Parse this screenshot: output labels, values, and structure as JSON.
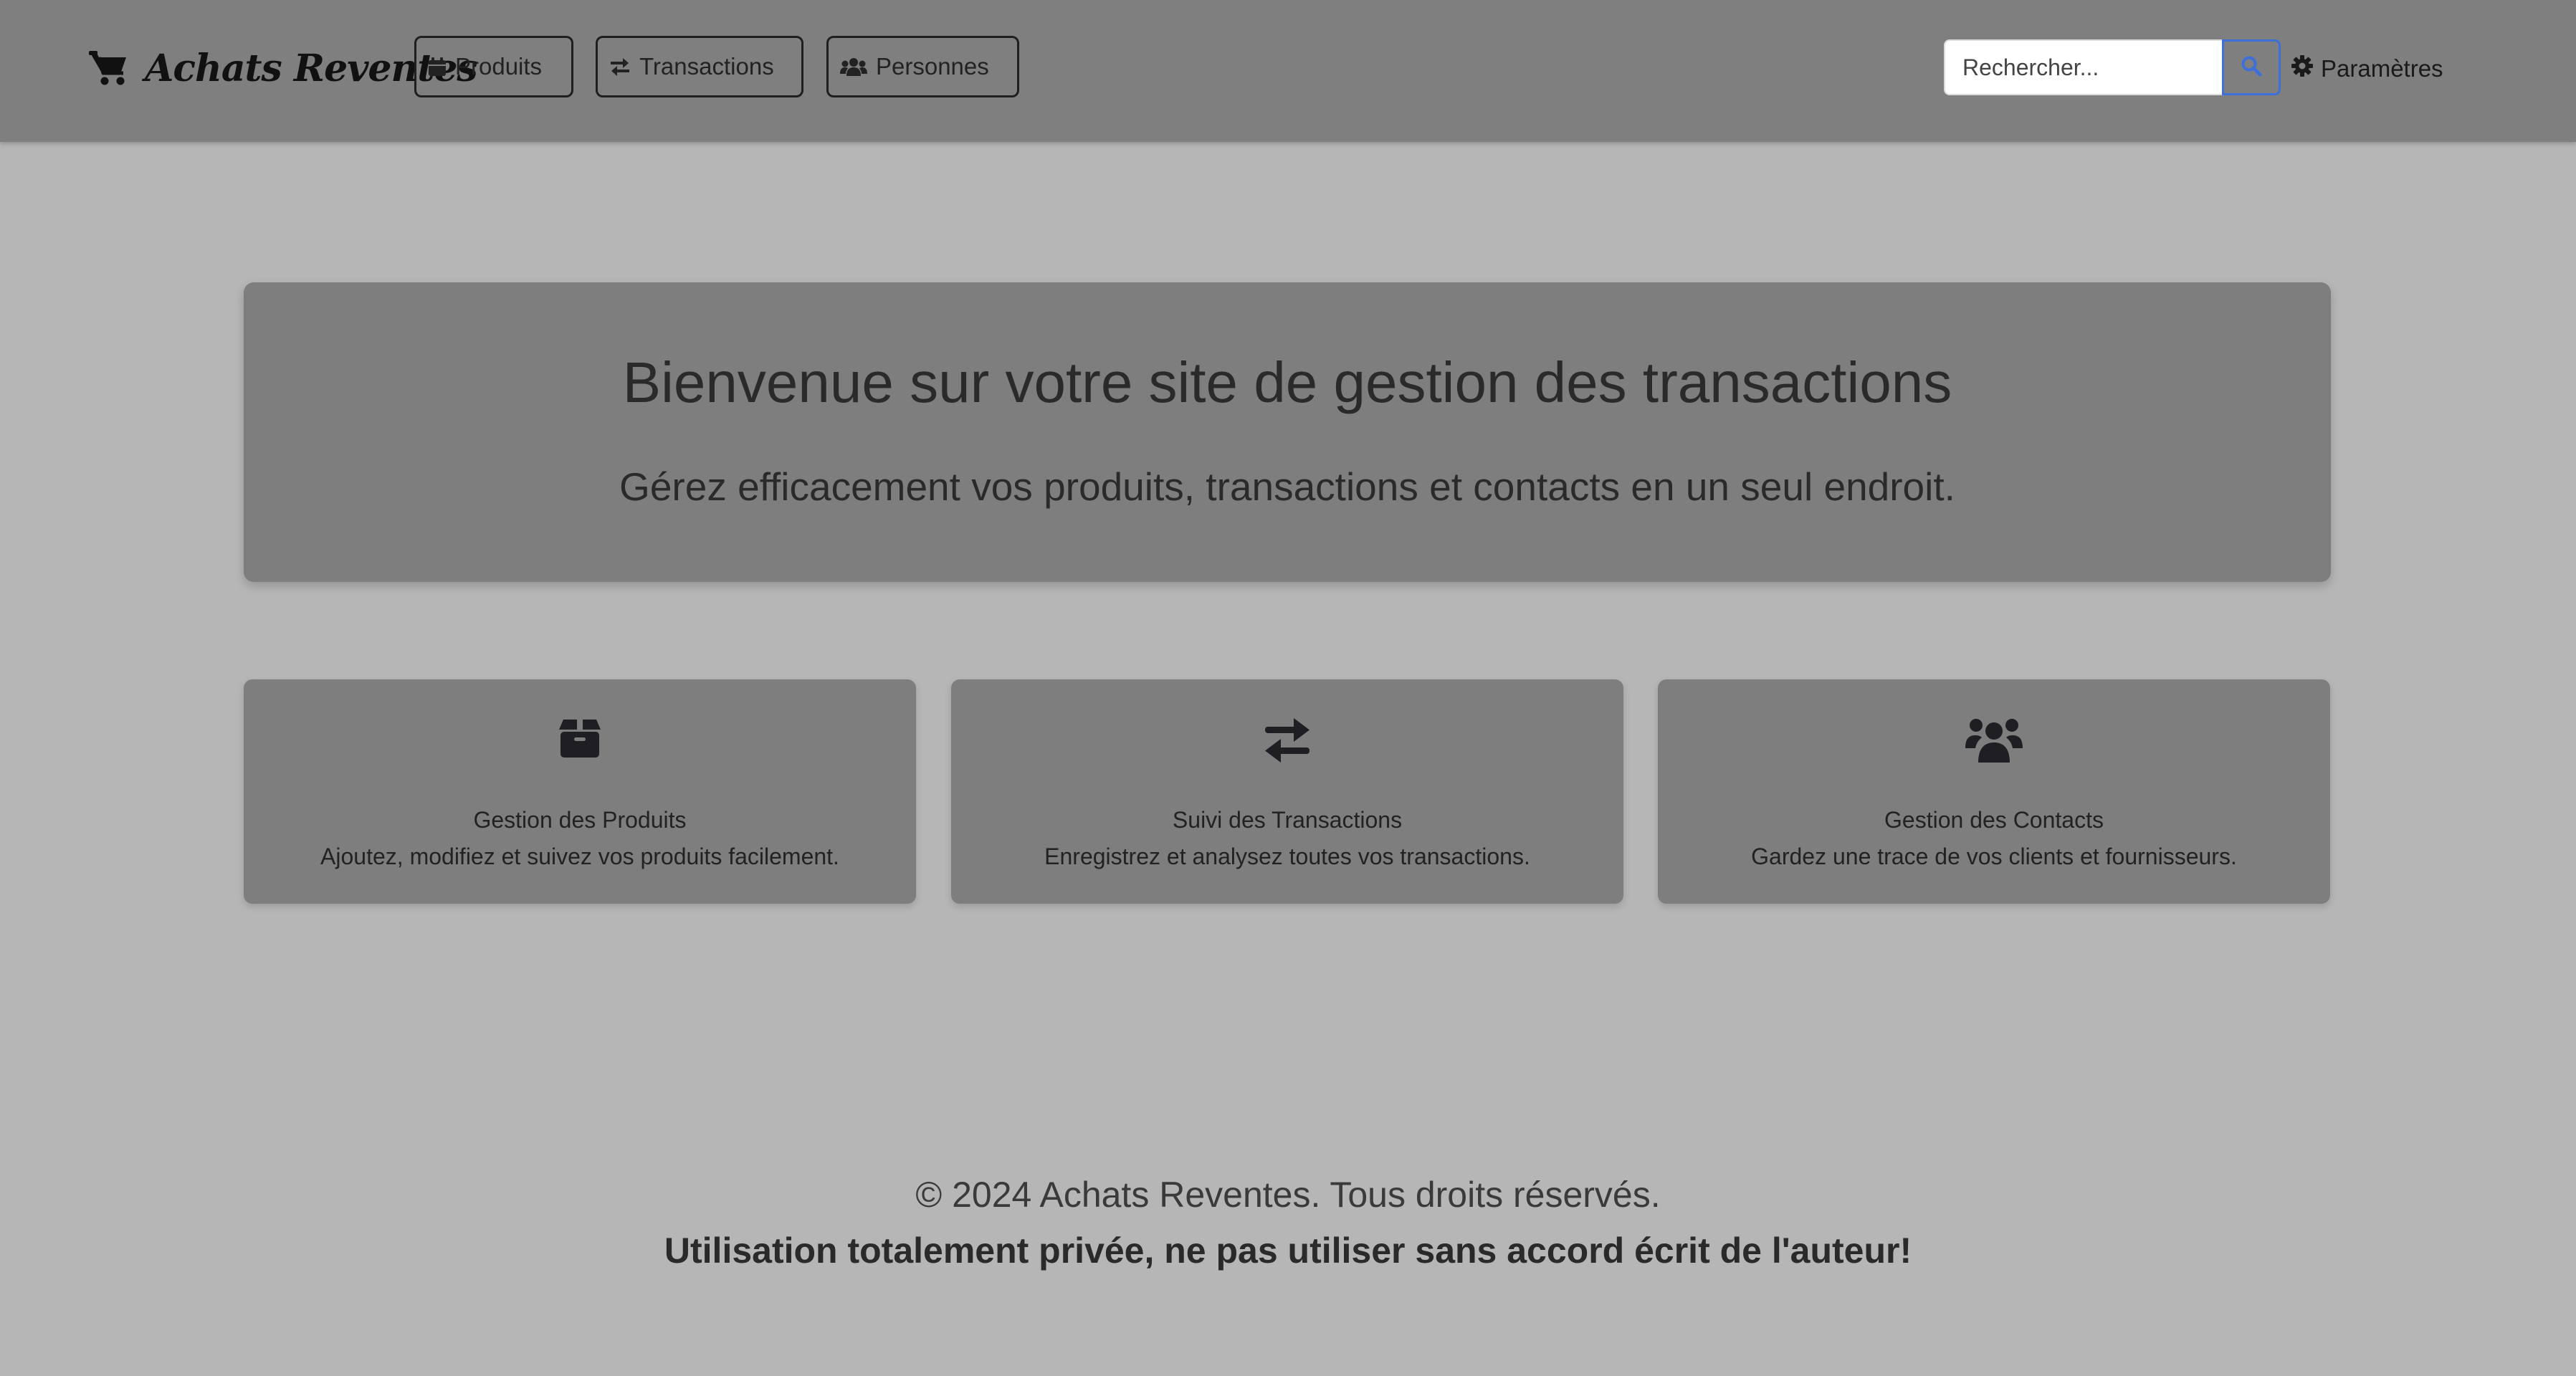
{
  "navbar": {
    "brand": {
      "icon": "shopping-cart-icon",
      "label": "Achats Reventes"
    },
    "buttons": [
      {
        "icon": "calendar-icon",
        "label": "Produits"
      },
      {
        "icon": "exchange-arrows-icon",
        "label": "Transactions"
      },
      {
        "icon": "users-icon",
        "label": "Personnes"
      }
    ],
    "search": {
      "placeholder": "Rechercher...",
      "value": "",
      "button_icon": "search-icon"
    },
    "settings": {
      "icon": "gear-icon",
      "label": "Paramètres"
    }
  },
  "hero": {
    "title": "Bienvenue sur votre site de gestion des transactions",
    "subtitle": "Gérez efficacement vos produits, transactions et contacts en un seul endroit."
  },
  "features": [
    {
      "icon": "box-icon",
      "title": "Gestion des Produits",
      "description": "Ajoutez, modifiez et suivez vos produits facilement."
    },
    {
      "icon": "exchange-arrows-icon",
      "title": "Suivi des Transactions",
      "description": "Enregistrez et analysez toutes vos transactions."
    },
    {
      "icon": "users-icon",
      "title": "Gestion des Contacts",
      "description": "Gardez une trace de vos clients et fournisseurs."
    }
  ],
  "footer": {
    "copyright": "© 2024 Achats Reventes. Tous droits réservés.",
    "warning": "Utilisation totalement privée, ne pas utiliser sans accord écrit de l'auteur!"
  },
  "colors": {
    "navbar_bg": "#7f7f7f",
    "page_bg": "#b6b6b6",
    "card_bg": "#7e7e7e",
    "search_accent": "#3d6fd9",
    "text": "#2b2b2b"
  }
}
